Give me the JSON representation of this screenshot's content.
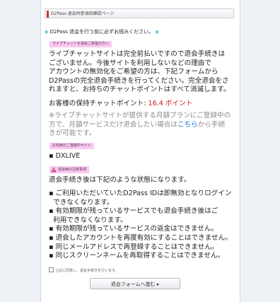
{
  "header": {
    "title": "D2Pass 退会同意項目確認ページ"
  },
  "lead": {
    "text": "D2Pass 退会を行う前に必ずお読みください。"
  },
  "section_chat": {
    "tag": "ライブチャットを退会ご希望の方へ",
    "para_lines": [
      "ライブチャットサイトは完全前払いですので退会手続きは",
      "ございません。今後サイトを利用しないなどの理由で",
      "アカウントの無効化をご希望の方は、下記フォームから",
      "D2Passの完全退会手続きを行ってください。完全退会をさ",
      "れますと、お持ちのチャットポイントはすべて消滅します。"
    ],
    "points_label": "お客様の保持チャットポイント: ",
    "points_value": "16.4 ポイント",
    "notice_lines": [
      "※ライブチャットサイトが提供する月額プランにご登録中の",
      "方で、月額サービスだけ退会したい場合は"
    ],
    "notice_link": "こちら",
    "notice_after_link": "から手続",
    "notice_last": "きが可能です。"
  },
  "section_sites": {
    "tag": "お利用のご登録中サイト",
    "sites": [
      "DXLIVE"
    ]
  },
  "section_warning": {
    "tag": "退会時の注意事項",
    "intro": "退会手続き後は下記のような状態になります。",
    "items": [
      [
        "ご利用いただいていたD2Pass IDは即無効となりログイン",
        "できなくなります。"
      ],
      [
        "有効期限が残っているサービスでも退会手続き後はご",
        "利用できなくなります。"
      ],
      [
        "有効期限が残っているサービスの返金はできません。"
      ],
      [
        "退会したアカウントを再度有効にすることはできません。"
      ],
      [
        "同じメールアドレスで再登録することはできません。"
      ],
      [
        "同じスクリーンネームを再取得することはできません。"
      ]
    ]
  },
  "agree_note": "上記に同意し、退会手続きを行います。",
  "submit_label": "退会フォームへ進む ▸",
  "colors": {
    "accent": "#c0392b",
    "tag_bg": "#f9c9ef",
    "link": "#1a6fd1",
    "points": "#d11a1a"
  }
}
